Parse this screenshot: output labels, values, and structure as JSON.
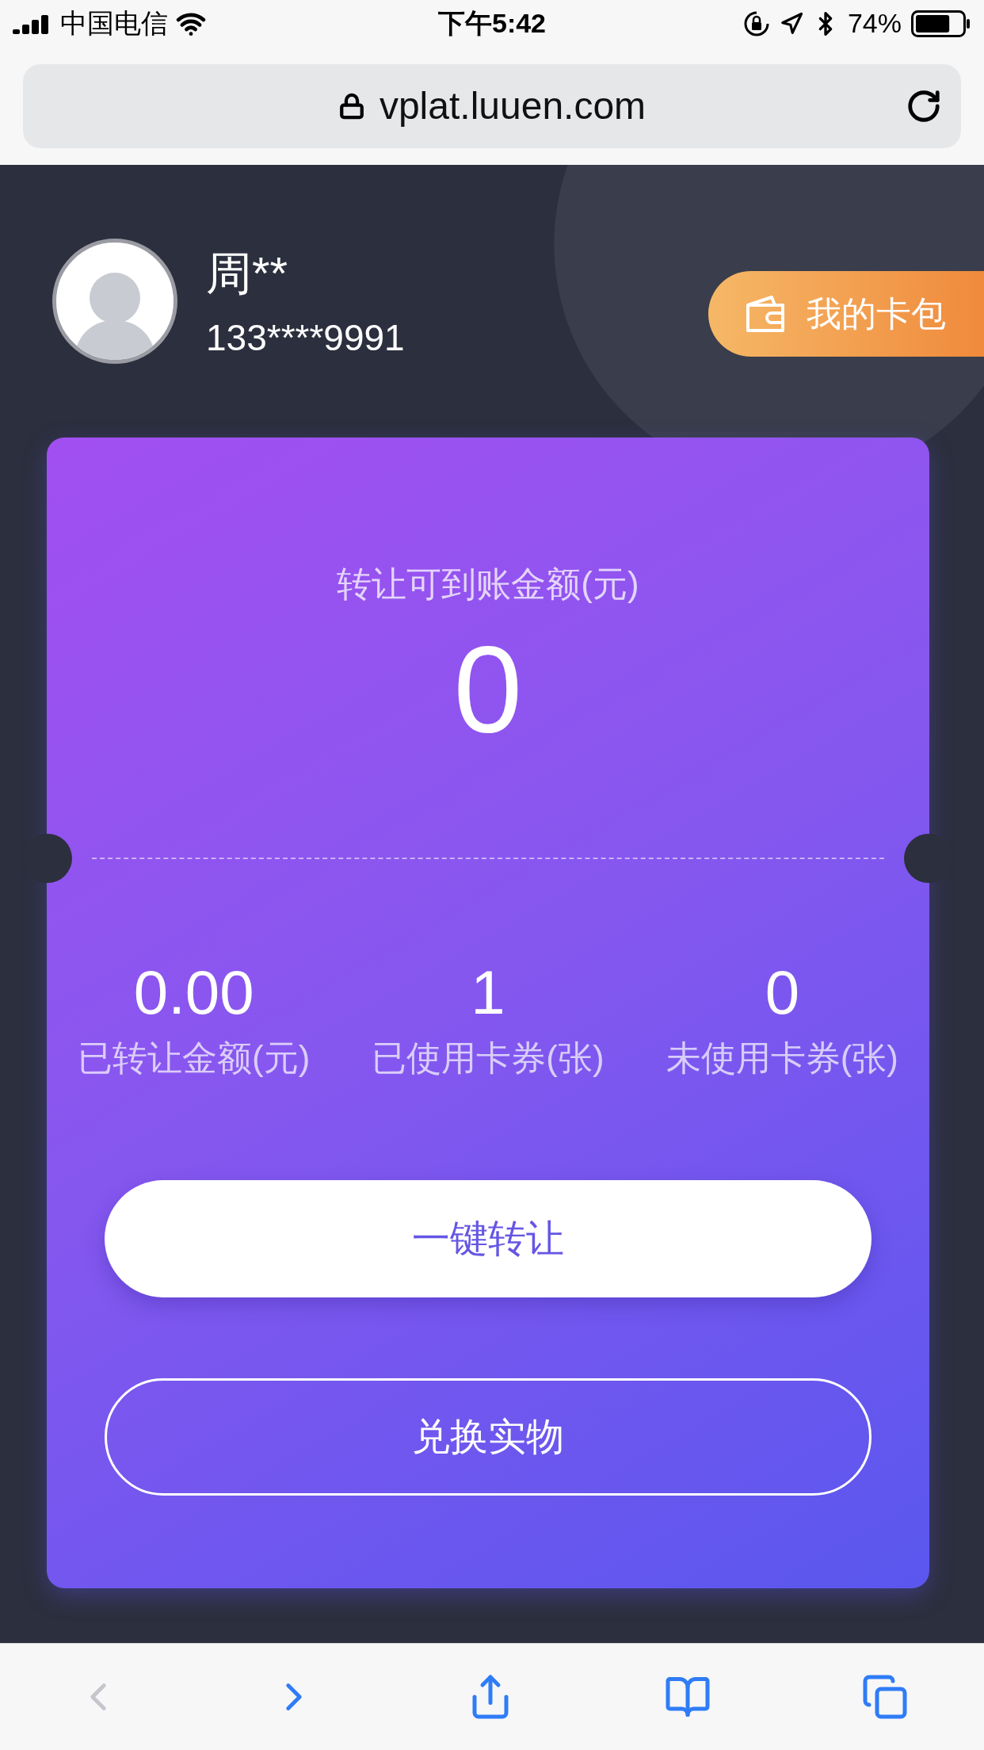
{
  "status_bar": {
    "carrier": "中国电信",
    "time": "下午5:42",
    "battery": "74%"
  },
  "browser": {
    "url": "vplat.luuen.com"
  },
  "user": {
    "name": "周**",
    "phone": "133****9991"
  },
  "wallet_button": {
    "label": "我的卡包"
  },
  "card": {
    "title": "转让可到账金额(元)",
    "amount": "0",
    "stats": [
      {
        "value": "0.00",
        "label": "已转让金额(元)"
      },
      {
        "value": "1",
        "label": "已使用卡券(张)"
      },
      {
        "value": "0",
        "label": "未使用卡券(张)"
      }
    ],
    "buttons": [
      {
        "label": "一键转让",
        "kind": "filled"
      },
      {
        "label": "兑换实物",
        "kind": "outline"
      }
    ]
  },
  "toolbar": [
    {
      "kind": "back",
      "disabled": true
    },
    {
      "kind": "forward",
      "disabled": false
    },
    {
      "kind": "share",
      "disabled": false
    },
    {
      "kind": "bookmarks",
      "disabled": false
    },
    {
      "kind": "tabs",
      "disabled": false
    }
  ]
}
